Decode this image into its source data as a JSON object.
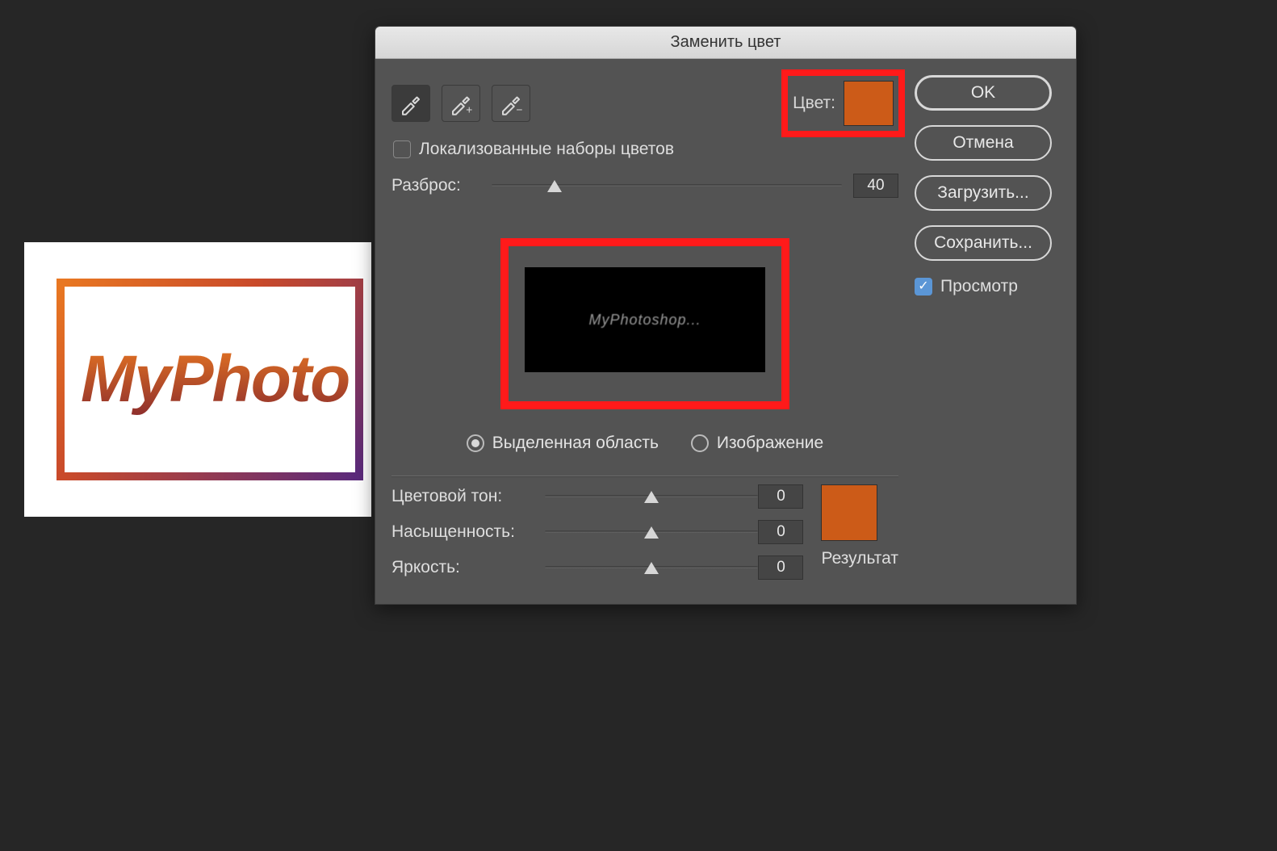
{
  "canvas": {
    "logo_text": "MyPhoto"
  },
  "dialog": {
    "title": "Заменить цвет",
    "localized_clusters_label": "Локализованные наборы цветов",
    "localized_clusters_checked": false,
    "color_label": "Цвет:",
    "color_swatch_hex": "#cc5b18",
    "fuzziness": {
      "label": "Разброс:",
      "value": "40",
      "pos_pct": 18
    },
    "preview_mask_text": "MyPhotoshop...",
    "view_mode": {
      "selection_label": "Выделенная область",
      "image_label": "Изображение",
      "selected": "selection"
    },
    "hue": {
      "label": "Цветовой тон:",
      "value": "0",
      "pos_pct": 50
    },
    "saturation": {
      "label": "Насыщенность:",
      "value": "0",
      "pos_pct": 50
    },
    "lightness": {
      "label": "Яркость:",
      "value": "0",
      "pos_pct": 50
    },
    "result_label": "Результат",
    "result_swatch_hex": "#cc5b18"
  },
  "buttons": {
    "ok": "OK",
    "cancel": "Отмена",
    "load": "Загрузить...",
    "save": "Сохранить...",
    "preview_label": "Просмотр",
    "preview_checked": true
  }
}
